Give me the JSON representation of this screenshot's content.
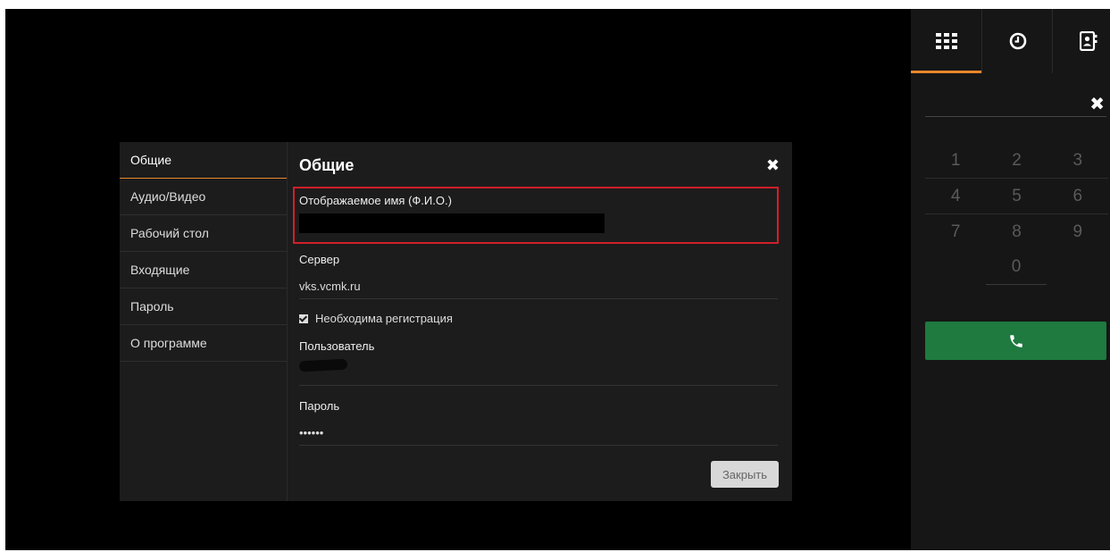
{
  "sidebar": {
    "items": [
      {
        "label": "Общие"
      },
      {
        "label": "Аудио/Видео"
      },
      {
        "label": "Рабочий стол"
      },
      {
        "label": "Входящие"
      },
      {
        "label": "Пароль"
      },
      {
        "label": "О программе"
      }
    ]
  },
  "dialog": {
    "title": "Общие",
    "display_name_label": "Отображаемое имя (Ф.И.О.)",
    "server_label": "Сервер",
    "server_value": "vks.vcmk.ru",
    "registration_label": "Необходима регистрация",
    "registration_checked": true,
    "user_label": "Пользователь",
    "password_label": "Пароль",
    "password_value": "••••••",
    "close_label": "Закрыть"
  },
  "dialer": {
    "tabs": [
      {
        "icon": "keypad-icon",
        "active": true
      },
      {
        "icon": "clock-icon",
        "active": false
      },
      {
        "icon": "contacts-icon",
        "active": false
      }
    ],
    "keys": [
      [
        "1",
        "2",
        "3"
      ],
      [
        "4",
        "5",
        "6"
      ],
      [
        "7",
        "8",
        "9"
      ]
    ],
    "zero": "0",
    "call_color": "#1e7a3f"
  },
  "colors": {
    "accent": "#e8862b",
    "highlight": "#d11f2a"
  }
}
